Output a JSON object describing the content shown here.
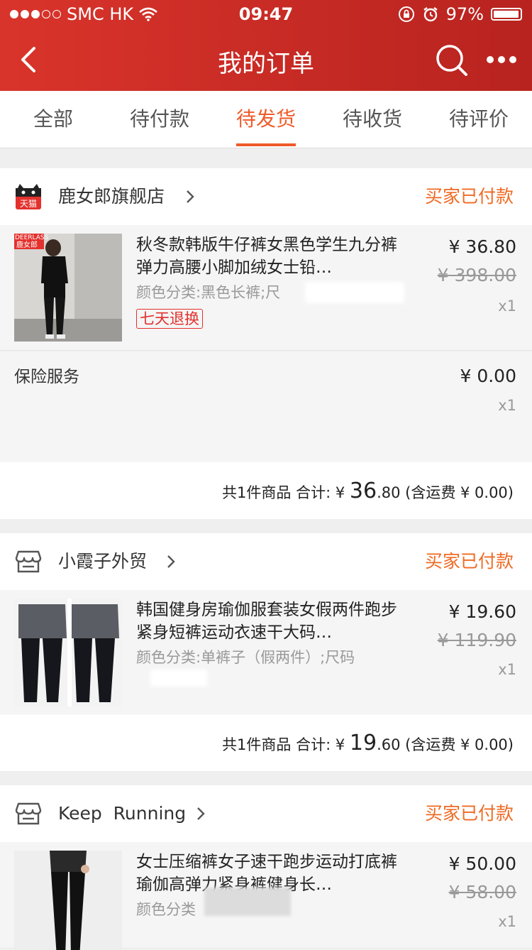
{
  "status_bar": {
    "carrier": "SMC HK",
    "time": "09:47",
    "battery_text": "97%",
    "battery_level": 0.97
  },
  "nav": {
    "title": "我的订单"
  },
  "tabs": [
    {
      "label": "全部"
    },
    {
      "label": "待付款"
    },
    {
      "label": "待发货",
      "active": true
    },
    {
      "label": "待收货"
    },
    {
      "label": "待评价"
    }
  ],
  "orders": [
    {
      "shop": "鹿女郎旗舰店",
      "status": "买家已付款",
      "item": {
        "title": "秋冬款韩版牛仔裤女黑色学生九分裤弹力高腰小脚加绒女士铅…",
        "sku": "颜色分类:黑色长裤;尺",
        "sku_tail": "]",
        "price": "¥ 36.80",
        "old_price": "¥ 398.00",
        "qty": "x1",
        "badge": "七天退换",
        "thumb_brand": "DEERLASS",
        "thumb_sub": "鹿女郎"
      },
      "insurance": {
        "label": "保险服务",
        "price": "¥ 0.00",
        "qty": "x1"
      },
      "summary": {
        "prefix": "共1件商品 合计: ¥ ",
        "big": "36",
        "small": ".80 (含运费 ¥ 0.00)"
      }
    },
    {
      "shop": "小霞子外贸",
      "status": "买家已付款",
      "item": {
        "title": "韩国健身房瑜伽服套装女假两件跑步紧身短裤运动衣速干大码…",
        "sku": "颜色分类:单裤子（假两件）;尺码",
        "price": "¥ 19.60",
        "old_price": "¥ 119.90",
        "qty": "x1"
      },
      "summary": {
        "prefix": "共1件商品 合计: ¥ ",
        "big": "19",
        "small": ".60 (含运费 ¥ 0.00)"
      }
    },
    {
      "shop": "Keep  Running",
      "status": "买家已付款",
      "item": {
        "title": "女士压缩裤女子速干跑步运动打底裤瑜伽高弹力紧身裤健身长…",
        "sku": "颜色分类",
        "price": "¥ 50.00",
        "old_price": "¥ 58.00",
        "qty": "x1"
      }
    }
  ],
  "colors": {
    "header_red": "#d9342b",
    "accent_orange": "#ef5b2a",
    "status_orange": "#ef6a23",
    "badge_red": "#e3312e"
  }
}
